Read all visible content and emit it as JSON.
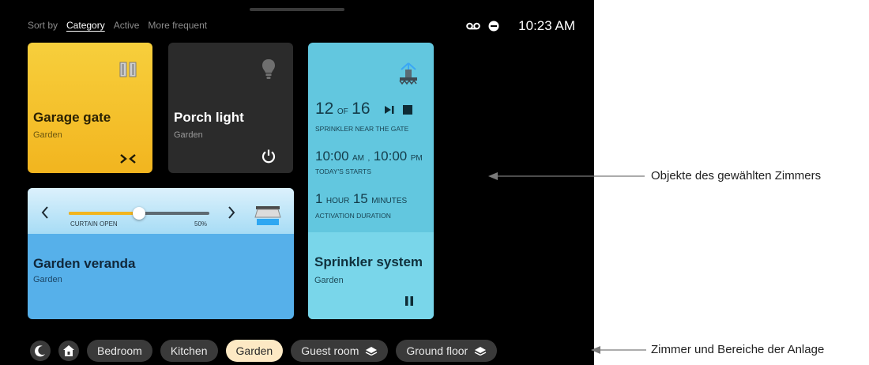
{
  "sort": {
    "label": "Sort by",
    "options": [
      "Category",
      "Active",
      "More frequent"
    ],
    "selected": "Category"
  },
  "status": {
    "time": "10:23 AM",
    "icons": [
      "voicemail-icon",
      "do-not-disturb-icon"
    ]
  },
  "cards": {
    "garage": {
      "title": "Garage gate",
      "room": "Garden",
      "icon": "garage-gate-icon",
      "action": "close-arrows-icon"
    },
    "porch": {
      "title": "Porch light",
      "room": "Garden",
      "icon": "light-bulb-icon",
      "action": "power-icon"
    },
    "veranda": {
      "title": "Garden veranda",
      "room": "Garden",
      "slider_label": "CURTAIN OPEN",
      "slider_value_text": "50%",
      "slider_value": 0.5,
      "icon": "awning-icon"
    },
    "sprinkler": {
      "title": "Sprinkler system",
      "room": "Garden",
      "zone_current": "12",
      "zone_of": "OF",
      "zone_total": "16",
      "zone_name": "SPRINKLER NEAR THE GATE",
      "start1": "10:00",
      "start1_suffix": "AM",
      "start_sep": ",",
      "start2": "10:00",
      "start2_suffix": "PM",
      "starts_label": "TODAY'S STARTS",
      "duration_hours": "1",
      "hours_label": "HOUR",
      "duration_minutes": "15",
      "minutes_label": "MINUTES",
      "duration_label": "ACTIVATION DURATION",
      "icon": "sprinkler-icon"
    }
  },
  "rooms": [
    "Bedroom",
    "Kitchen",
    "Garden",
    "Guest room",
    "Ground floor"
  ],
  "selected_room": "Garden",
  "annotations": {
    "objects": "Objekte des gewählten Zimmers",
    "rooms": "Zimmer und Bereiche der Anlage"
  }
}
